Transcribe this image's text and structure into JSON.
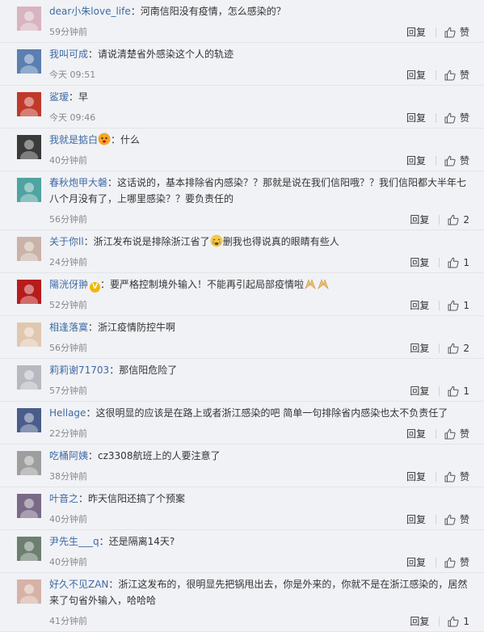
{
  "reply_label": "回复",
  "comments": [
    {
      "user": "dear小朱love_life",
      "text": "：河南信阳没有疫情，怎么感染的？",
      "time": "59分钟前",
      "like": "赞",
      "avatar_color": "#d8b4c0"
    },
    {
      "user": "我叫可成",
      "text": "：请说清楚省外感染这个人的轨迹",
      "time": "今天 09:51",
      "like": "赞",
      "avatar_color": "#5a7fb0"
    },
    {
      "user": "鲨瑷",
      "text": "：早",
      "time": "今天 09:46",
      "like": "赞",
      "avatar_color": "#c0392b"
    },
    {
      "user": "我就是掂白",
      "text_after": "：什么",
      "time": "40分钟前",
      "like": "赞",
      "avatar_color": "#3a3a3a",
      "emoji": "face-emoji"
    },
    {
      "user": "春秋炮甲大磐",
      "text": "：这话说的，基本排除省内感染？？那就是说在我们信阳哦？？我们信阳都大半年七八个月没有了，上哪里感染？？要负责任的",
      "time": "56分钟前",
      "like": "2",
      "avatar_color": "#4fa3a0"
    },
    {
      "user": "关于你ll",
      "text": "：浙江发布说是排除浙江省了",
      "text_after": "删我也得说真的眼睛有些人",
      "time": "24分钟前",
      "like": "1",
      "avatar_color": "#c9b3a8",
      "emoji": "crying-face-emoji"
    },
    {
      "user": "陽洸伢翀",
      "text": "：要严格控制境外输入！不能再引起局部疫情啦",
      "time": "52分钟前",
      "like": "1",
      "avatar_color": "#b71c1c",
      "emoji": "pray-hands-emoji",
      "badge": "V"
    },
    {
      "user": "相逢落寞",
      "text": "：浙江疫情防控牛啊",
      "time": "56分钟前",
      "like": "2",
      "avatar_color": "#e0c8b0"
    },
    {
      "user": "莉莉谢71703",
      "text": "：那信阳危险了",
      "time": "57分钟前",
      "like": "1",
      "avatar_color": "#b8b8c0"
    },
    {
      "user": "Hellage",
      "text": "：这很明显的应该是在路上或者浙江感染的吧 简单一句排除省内感染也太不负责任了",
      "time": "22分钟前",
      "like": "赞",
      "avatar_color": "#4a5d8a"
    },
    {
      "user": "吃桶阿姨",
      "text": "：cz3308航班上的人要注意了",
      "time": "38分钟前",
      "like": "赞",
      "avatar_color": "#9e9e9e"
    },
    {
      "user": "叶音之",
      "text": "：昨天信阳还搞了个预案",
      "time": "40分钟前",
      "like": "赞",
      "avatar_color": "#7a6a88"
    },
    {
      "user": "尹先生___q",
      "text": "：还是隔离14天?",
      "time": "40分钟前",
      "like": "赞",
      "avatar_color": "#6d7f70"
    },
    {
      "user": "好久不见ZAN",
      "text": "：浙江这发布的，很明显先把锅甩出去，你是外来的，你就不是在浙江感染的，居然来了句省外输入，哈哈哈",
      "time": "41分钟前",
      "like": "1",
      "avatar_color": "#d6b2a6"
    }
  ]
}
